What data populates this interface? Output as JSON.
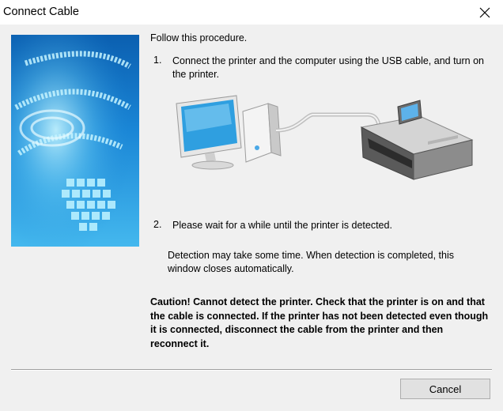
{
  "window": {
    "title": "Connect Cable",
    "close_icon": "close-icon"
  },
  "content": {
    "intro": "Follow this procedure.",
    "steps": [
      {
        "number": "1.",
        "text": "Connect the printer and the computer using the USB cable, and turn on the printer."
      },
      {
        "number": "2.",
        "text": "Please wait for a while until the printer is detected."
      }
    ],
    "detection_note": "Detection may take some time. When detection is completed, this window closes automatically.",
    "caution": "Caution! Cannot detect the printer. Check that the printer is on and that the cable is connected. If the printer has not been detected even though it is connected, disconnect the cable from the printer and then reconnect it."
  },
  "buttons": {
    "cancel": "Cancel"
  },
  "illustration": {
    "computer_icon": "desktop-computer-icon",
    "printer_icon": "printer-icon",
    "banner_accent": "#1e90d8"
  }
}
